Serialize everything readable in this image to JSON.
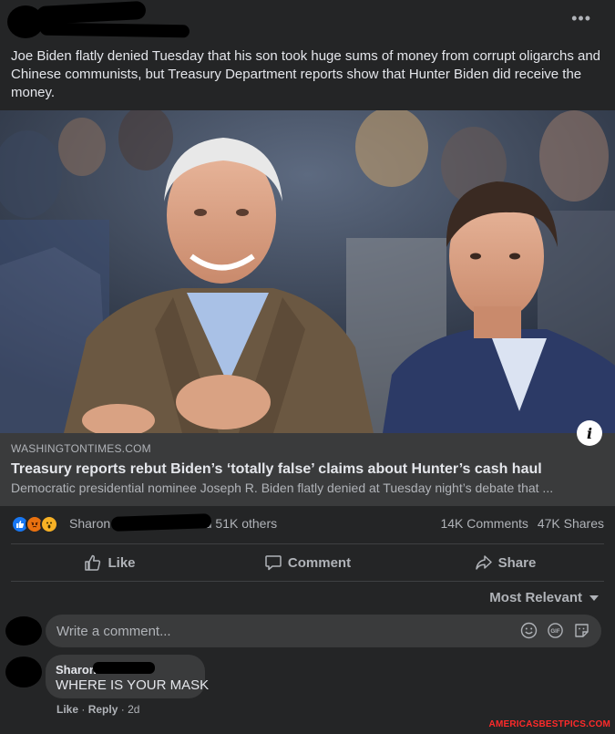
{
  "post": {
    "more_label": "•••",
    "text": "Joe Biden flatly denied Tuesday that his son took huge sums of money from corrupt oligarchs and Chinese communists, but Treasury Department reports show that Hunter Biden did receive the money."
  },
  "link": {
    "domain": "WASHINGTONTIMES.COM",
    "title": "Treasury reports rebut Biden’s ‘totally false’ claims about Hunter’s cash haul",
    "description": "Democratic presidential nominee Joseph R. Biden flatly denied at Tuesday night’s debate that ...",
    "info_label": "i"
  },
  "reactions": {
    "icons": [
      "like-icon",
      "angry-icon",
      "wow-icon"
    ],
    "names_prefix": "Sharon",
    "names_suffix": "and 51K others",
    "comments": "14K Comments",
    "shares": "47K Shares"
  },
  "actions": {
    "like": "Like",
    "comment": "Comment",
    "share": "Share"
  },
  "comments": {
    "sort_label": "Most Relevant",
    "input_placeholder": "Write a comment...",
    "items": [
      {
        "author": "Sharon",
        "text": "WHERE IS YOUR MASK",
        "like": "Like",
        "reply": "Reply",
        "age": "2d"
      }
    ]
  },
  "watermark": "AMERICASBESTPICS.COM",
  "colors": {
    "background": "#242526",
    "link_box": "#3a3b3c",
    "text_primary": "#e4e6eb",
    "text_secondary": "#b0b3b8",
    "like_blue": "#1877f2",
    "watermark_red": "#ff2a2a"
  }
}
